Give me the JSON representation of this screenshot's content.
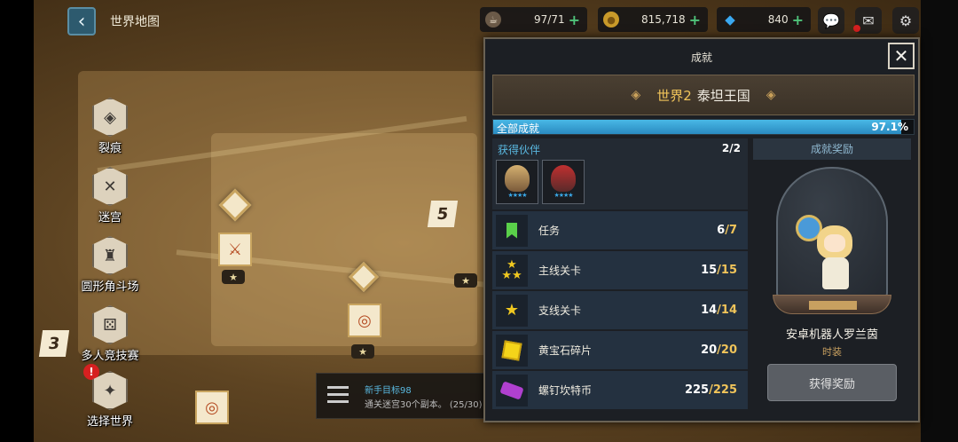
{
  "header": {
    "title": "世界地图",
    "resources": [
      {
        "icon": "stamina-cup-icon",
        "value": "97/71"
      },
      {
        "icon": "gold-coin-icon",
        "value": "815,718"
      },
      {
        "icon": "gem-icon",
        "value": "840"
      }
    ]
  },
  "left_menu": [
    {
      "label": "裂痕",
      "icon": "rift-emblem-icon"
    },
    {
      "label": "迷宫",
      "icon": "labyrinth-emblem-icon"
    },
    {
      "label": "圆形角斗场",
      "icon": "colosseum-emblem-icon"
    },
    {
      "label": "多人竞技赛",
      "icon": "multiplayer-dice-icon"
    },
    {
      "label": "选择世界",
      "icon": "world-compass-icon"
    }
  ],
  "map": {
    "stage_numbers": [
      "5",
      "3"
    ],
    "star_chip": "★"
  },
  "quest": {
    "title": "新手目标98",
    "desc": "通关迷宫30个副本。 (25/30)"
  },
  "panel": {
    "title": "成就",
    "world_number": "世界2",
    "world_name": "泰坦王国",
    "progress_label": "全部成就",
    "progress_value": "97.1%",
    "progress_fraction": 0.971,
    "partners": {
      "label": "获得伙伴",
      "count": "2/2"
    },
    "rows": [
      {
        "label": "任务",
        "num": "6",
        "den": "/7",
        "icon": "bookmark-icon"
      },
      {
        "label": "主线关卡",
        "num": "15",
        "den": "/15",
        "icon": "three-stars-icon"
      },
      {
        "label": "支线关卡",
        "num": "14",
        "den": "/14",
        "icon": "star-icon"
      },
      {
        "label": "黄宝石碎片",
        "num": "20",
        "den": "/20",
        "icon": "topaz-cube-icon"
      },
      {
        "label": "螺钉坎特币",
        "num": "225",
        "den": "/225",
        "icon": "screw-coin-icon"
      }
    ],
    "reward": {
      "header": "成就奖励",
      "name": "安卓机器人罗兰茵",
      "type": "时装",
      "claim_label": "获得奖励"
    }
  },
  "colors": {
    "accent_blue": "#49b8e6",
    "gold": "#f0c45a",
    "green_plus": "#4fc37a"
  }
}
